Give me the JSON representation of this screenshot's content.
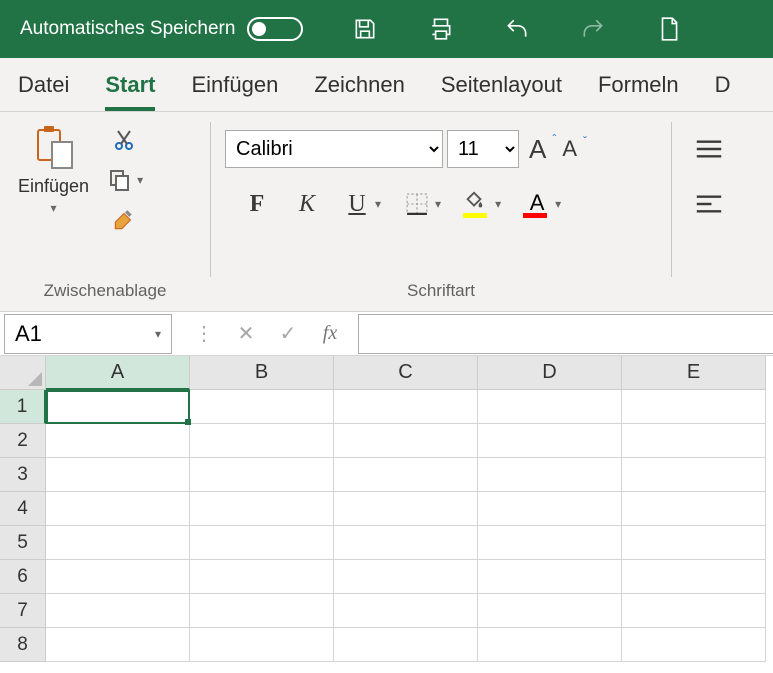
{
  "titlebar": {
    "autosave_label": "Automatisches Speichern"
  },
  "tabs": {
    "items": [
      "Datei",
      "Start",
      "Einfügen",
      "Zeichnen",
      "Seitenlayout",
      "Formeln",
      "D"
    ],
    "active_index": 1
  },
  "ribbon": {
    "clipboard": {
      "paste_label": "Einfügen",
      "group_label": "Zwischenablage"
    },
    "font": {
      "name": "Calibri",
      "size": "11",
      "group_label": "Schriftart",
      "bold": "F",
      "italic": "K",
      "underline": "U",
      "grow": "A",
      "shrink": "A",
      "font_color_letter": "A",
      "fill_color": "#ffff00",
      "font_color": "#ff0000"
    }
  },
  "namebox": {
    "value": "A1"
  },
  "formula": {
    "value": ""
  },
  "grid": {
    "columns": [
      "A",
      "B",
      "C",
      "D",
      "E"
    ],
    "rows": [
      "1",
      "2",
      "3",
      "4",
      "5",
      "6",
      "7",
      "8"
    ],
    "active_cell": "A1"
  }
}
